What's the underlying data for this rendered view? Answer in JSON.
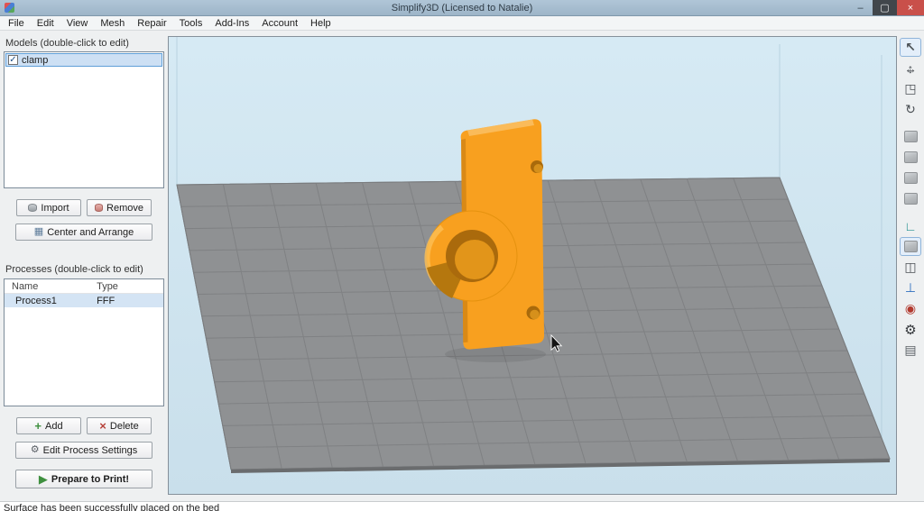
{
  "window": {
    "title": "Simplify3D (Licensed to Natalie)",
    "controls": {
      "minimize": "–",
      "maximize": "▢",
      "close": "×"
    }
  },
  "menu": {
    "items": [
      "File",
      "Edit",
      "View",
      "Mesh",
      "Repair",
      "Tools",
      "Add-Ins",
      "Account",
      "Help"
    ]
  },
  "sidebar": {
    "models_header": "Models (double-click to edit)",
    "models": [
      {
        "name": "clamp",
        "checked": true,
        "selected": true
      }
    ],
    "processes_header": "Processes (double-click to edit)",
    "process_table": {
      "columns": [
        "Name",
        "Type"
      ],
      "rows": [
        {
          "name": "Process1",
          "type": "FFF",
          "selected": true
        }
      ]
    },
    "buttons": {
      "import": {
        "label": "Import"
      },
      "remove": {
        "label": "Remove"
      },
      "center_arrange": {
        "label": "Center and Arrange",
        "glyph": "▦"
      },
      "add": {
        "label": "Add",
        "glyph": "+"
      },
      "delete": {
        "label": "Delete",
        "glyph": "×"
      },
      "edit_process_settings": {
        "label": "Edit Process Settings",
        "glyph": "⚙"
      },
      "prepare_to_print": {
        "label": "Prepare to Print!",
        "glyph": "▶"
      }
    }
  },
  "toolbar": {
    "buttons": [
      {
        "name": "select-tool",
        "glyph": "↖",
        "selected": true
      },
      {
        "name": "translate-tool",
        "glyph": "↔",
        "glyph2": "↕"
      },
      {
        "name": "scale-tool",
        "glyph": "◳"
      },
      {
        "name": "rotate-tool",
        "glyph": "↻"
      },
      {
        "name": "view-cube-top",
        "cube": true
      },
      {
        "name": "view-cube-front",
        "cube": true
      },
      {
        "name": "view-cube-side",
        "cube": true
      },
      {
        "name": "view-cube-iso",
        "cube": true
      },
      {
        "name": "coordinate-axes",
        "glyph": "∟"
      },
      {
        "name": "view-cube-active",
        "cube": true,
        "selected": true
      },
      {
        "name": "cross-section",
        "glyph": "◫"
      },
      {
        "name": "support-structures",
        "glyph": "⊥"
      },
      {
        "name": "support-paint",
        "glyph": "◉"
      },
      {
        "name": "machine-settings",
        "glyph": "⚙"
      },
      {
        "name": "measurement",
        "glyph": "▤"
      }
    ]
  },
  "viewport": {
    "model_name": "clamp",
    "model_color": "#f8a01f",
    "plate_color": "#8f9193",
    "grid_color": "#7c7e80",
    "background_top": "#d6eaf4",
    "background_bottom": "#c9dfeb"
  },
  "statusbar": {
    "message": "Surface has been successfully placed on the bed"
  },
  "icons": {
    "check": "✓"
  }
}
